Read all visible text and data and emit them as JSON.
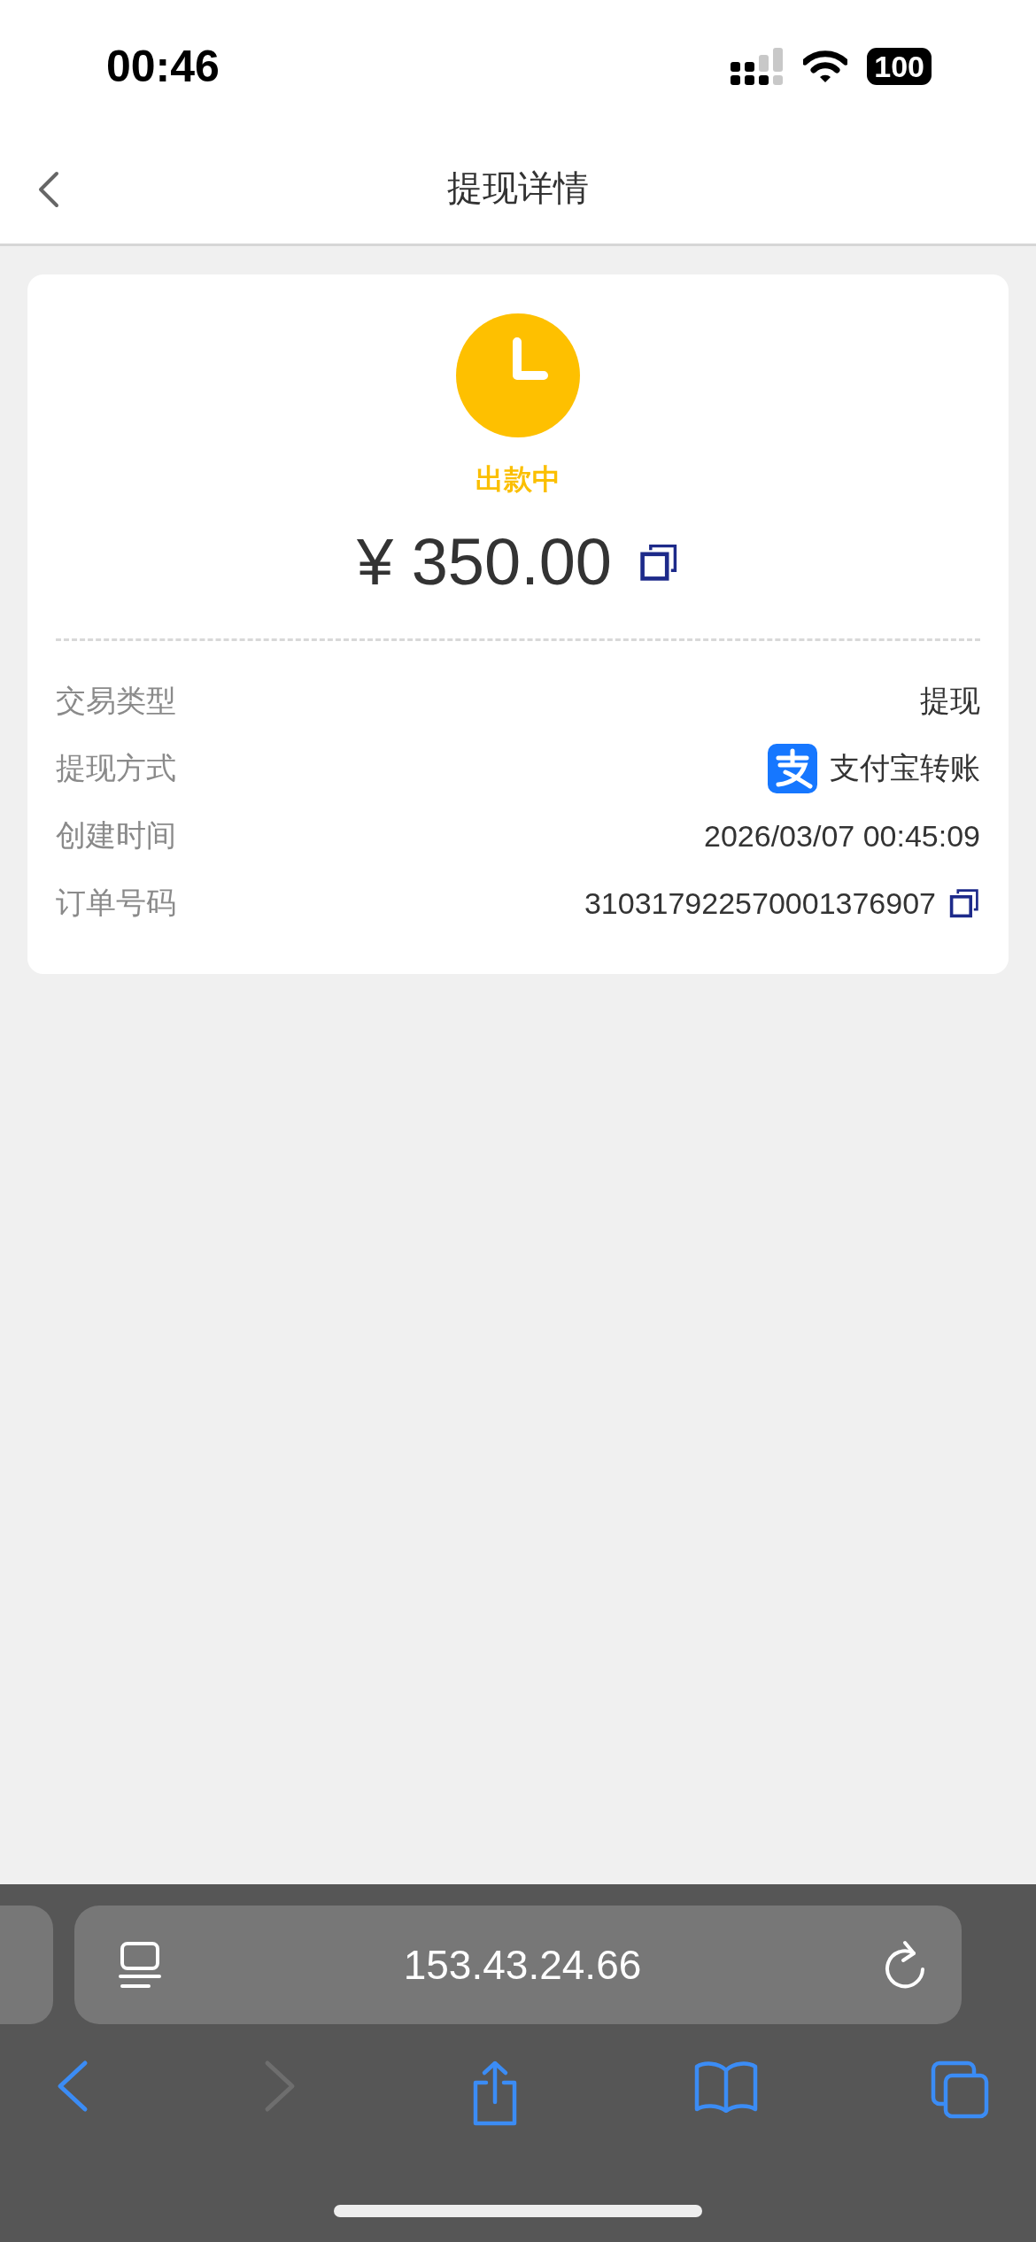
{
  "status_bar": {
    "time": "00:46",
    "battery": "100"
  },
  "nav": {
    "title": "提现详情"
  },
  "summary": {
    "status": "出款中",
    "amount": "¥ 350.00",
    "copyable": true
  },
  "details": [
    {
      "label": "交易类型",
      "value": "提现",
      "kind": "plain",
      "copyable": false
    },
    {
      "label": "提现方式",
      "value": "支付宝转账",
      "kind": "alipay",
      "copyable": false
    },
    {
      "label": "创建时间",
      "value": "2026/03/07 00:45:09",
      "kind": "plain",
      "copyable": false
    },
    {
      "label": "订单号码",
      "value": "310317922570001376907",
      "kind": "plain",
      "copyable": true
    }
  ],
  "browser": {
    "url": "153.43.24.66",
    "toolbar": [
      {
        "kind": "back",
        "disabled": false
      },
      {
        "kind": "forward",
        "disabled": true
      },
      {
        "kind": "share",
        "disabled": false
      },
      {
        "kind": "bookmarks",
        "disabled": false
      },
      {
        "kind": "tabs",
        "disabled": false
      }
    ]
  }
}
